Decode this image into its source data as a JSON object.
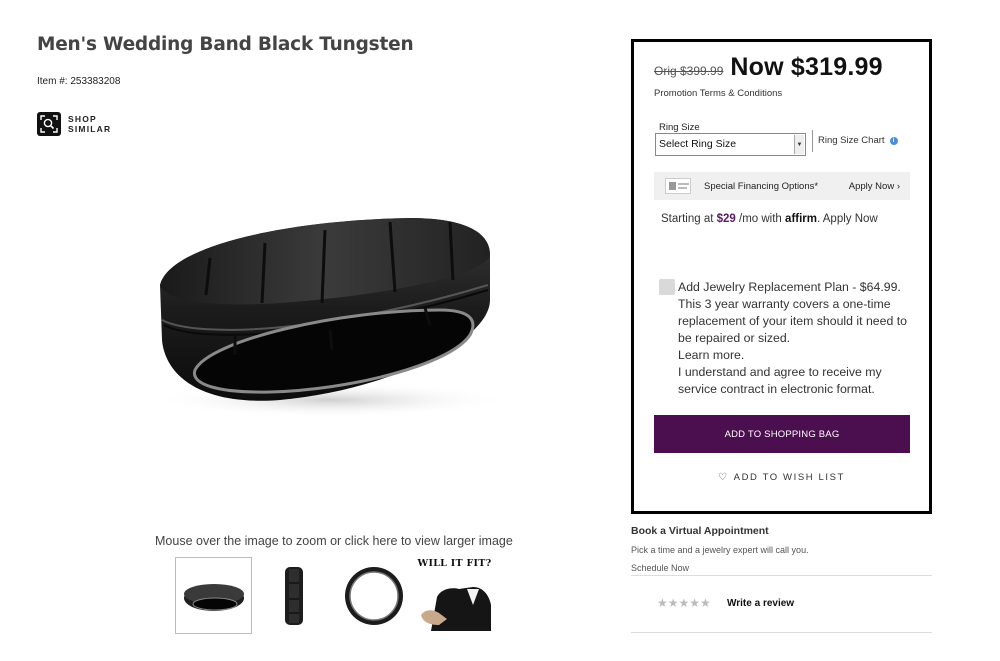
{
  "product": {
    "title": "Men's Wedding Band Black Tungsten",
    "item_number": "Item #: 253383208",
    "shop_similar_label_1": "SHOP",
    "shop_similar_label_2": "SIMILAR"
  },
  "gallery": {
    "zoom_hint": "Mouse over the image to zoom or click here to view larger image",
    "thumbnails": [
      {
        "name": "thumb-angle-view",
        "selected": true
      },
      {
        "name": "thumb-side-view",
        "selected": false
      },
      {
        "name": "thumb-top-view",
        "selected": false
      },
      {
        "name": "thumb-will-it-fit",
        "selected": false,
        "label": "WILL IT FIT?"
      }
    ]
  },
  "buybox": {
    "orig_price": "Orig $399.99",
    "now_price": "Now $319.99",
    "promo_terms": "Promotion Terms & Conditions",
    "ring_size_label": "Ring Size",
    "ring_size_selected": "Select Ring Size",
    "ring_size_chart": "Ring Size Chart",
    "financing_text": "Special Financing Options*",
    "financing_apply": "Apply Now",
    "affirm_prefix": "Starting at",
    "affirm_amount": "$29",
    "affirm_suffix": "/mo with",
    "affirm_logo": "affirm",
    "affirm_apply": ". Apply Now",
    "plan_text": "Add Jewelry Replacement Plan - $64.99. This 3 year warranty covers a one-time replacement of your item should it need to be repaired or sized.",
    "plan_learn_more": "Learn more.",
    "plan_agree": "I understand and agree to receive my service contract in electronic format.",
    "add_to_bag": "ADD TO SHOPPING BAG",
    "add_to_wishlist": "ADD TO WISH LIST"
  },
  "appointment": {
    "title": "Book a Virtual Appointment",
    "subtitle": "Pick a time and a jewelry expert will call you.",
    "link": "Schedule Now"
  },
  "reviews": {
    "stars": "★★★★★",
    "rating": 0,
    "write_review": "Write a review"
  },
  "colors": {
    "accent": "#4b0f4f",
    "affirm_amount": "#5b1a63",
    "info": "#4a8fd8"
  },
  "icons": [
    "search-frame-icon",
    "info-icon",
    "heart-icon",
    "chevron-right-icon",
    "dropdown-arrow-icon",
    "star-icon"
  ]
}
